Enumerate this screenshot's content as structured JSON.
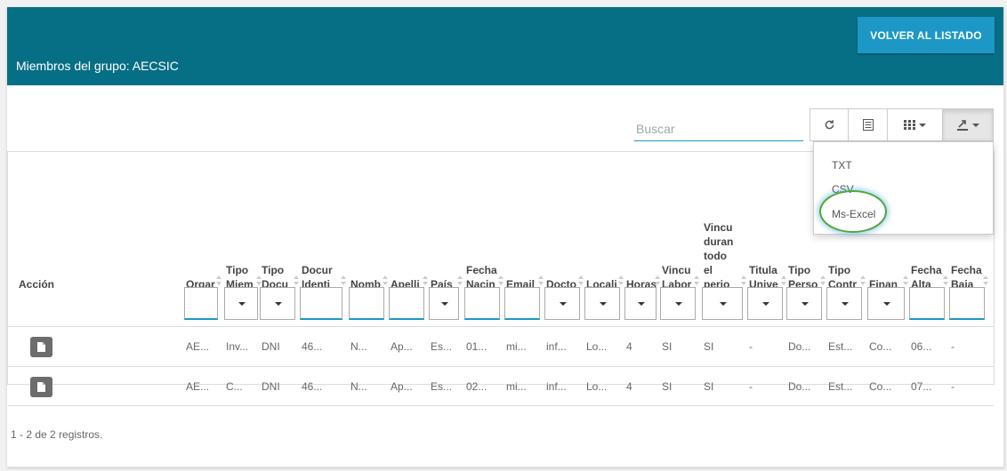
{
  "header": {
    "title": "Miembros del grupo: AECSIC",
    "back_button": "VOLVER AL LISTADO"
  },
  "toolbar": {
    "search_placeholder": "Buscar",
    "refresh_icon": "refresh-icon",
    "toggle_icon": "list-view-icon",
    "columns_icon": "grid-columns-icon",
    "export_icon": "export-icon"
  },
  "table": {
    "action_header": "Acción",
    "columns": [
      [
        "Orgar"
      ],
      [
        "Tipo",
        "Miem"
      ],
      [
        "Tipo",
        "Docu"
      ],
      [
        "Docur",
        "Identi"
      ],
      [
        "Nomb"
      ],
      [
        "Apelli"
      ],
      [
        "País"
      ],
      [
        "Fecha",
        "Nacin"
      ],
      [
        "Email"
      ],
      [
        "Docto"
      ],
      [
        "Locali"
      ],
      [
        "Horas"
      ],
      [
        "Vincu",
        "Labor"
      ],
      [
        "Vincu",
        "duran",
        "todo",
        "el",
        "perio"
      ],
      [
        "Titula",
        "Unive"
      ],
      [
        "Tipo",
        "Perso"
      ],
      [
        "Tipo",
        "Contr"
      ],
      [
        "Finan"
      ],
      [
        "Fecha",
        "Alta"
      ],
      [
        "Fecha",
        "Baja"
      ]
    ],
    "rows": [
      [
        "AE...",
        "Inv...",
        "DNI",
        "46...",
        "N...",
        "Ap...",
        "Es...",
        "01...",
        "mi...",
        "inf...",
        "Lo...",
        "4",
        "SI",
        "SI",
        "-",
        "Do...",
        "Est...",
        "Co...",
        "06...",
        "-"
      ],
      [
        "AE...",
        "C...",
        "DNI",
        "46...",
        "N...",
        "Ap...",
        "Es...",
        "02...",
        "mi...",
        "inf...",
        "Lo...",
        "4",
        "SI",
        "SI",
        "-",
        "Do...",
        "Est...",
        "Co...",
        "07...",
        "-"
      ]
    ],
    "action_icon": "document-icon"
  },
  "footer": {
    "records": "1 - 2 de 2 registros."
  },
  "export_menu": {
    "items": [
      "TXT",
      "CSV",
      "Ms-Excel"
    ]
  },
  "colors": {
    "header_bg": "#076f85",
    "button_bg": "#1d98c6",
    "highlight_ring": "#4ca83a"
  }
}
